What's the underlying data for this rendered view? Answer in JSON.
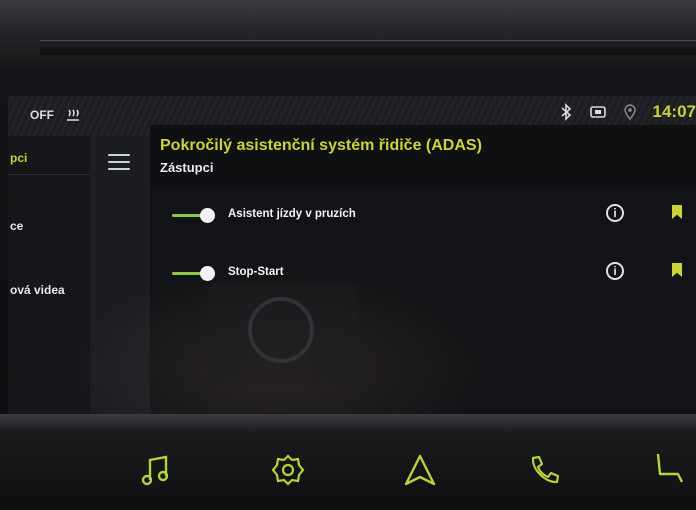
{
  "status_bar": {
    "climate_label": "OFF",
    "clock": "14:07"
  },
  "side_panel": {
    "items": [
      {
        "label": "pci"
      },
      {
        "label": "ce"
      },
      {
        "label": "ová videa"
      }
    ]
  },
  "header": {
    "title": "Pokročilý asistenční systém řidiče (ADAS)",
    "subtitle": "Zástupci"
  },
  "rows": [
    {
      "label": "Asistent jízdy v pruzích",
      "toggle_on": true,
      "info_icon": "i"
    },
    {
      "label": "Stop-Start",
      "toggle_on": true,
      "info_icon": "i"
    }
  ],
  "dock": {
    "items": [
      "music-icon",
      "settings-gear-icon",
      "navigation-arrow-icon",
      "phone-icon",
      "seat-icon"
    ]
  },
  "colors": {
    "accent": "#c8d43a",
    "toggle_green": "#8dc63f",
    "background": "#121316"
  }
}
